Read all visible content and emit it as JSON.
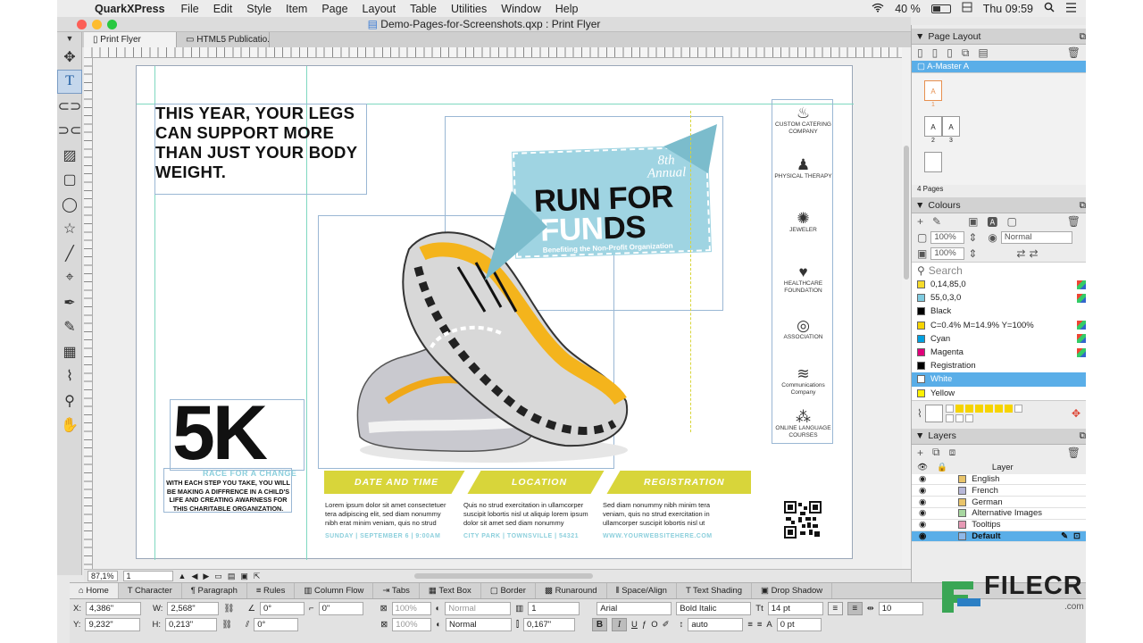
{
  "menubar": {
    "apple_icon": "apple-icon",
    "app_name": "QuarkXPress",
    "menus": [
      "File",
      "Edit",
      "Style",
      "Item",
      "Page",
      "Layout",
      "Table",
      "Utilities",
      "Window",
      "Help"
    ],
    "battery": "40 %",
    "clock": "Thu 09:59"
  },
  "window": {
    "title": "Demo-Pages-for-Screenshots.qxp : Print Flyer",
    "tabs": [
      "Print Flyer",
      "HTML5 Publicatio..."
    ]
  },
  "tools": [
    "pointer-tool",
    "text-content-tool",
    "picture-content-tool",
    "linking-tool",
    "picture-box-tool",
    "rectangle-box-tool",
    "oval-box-tool",
    "star-box-tool",
    "line-tool",
    "bezier-pen-tool",
    "scissors-tool",
    "freehand-tool",
    "table-tool",
    "eyedropper-tool",
    "zoom-tool",
    "pan-tool"
  ],
  "flyer": {
    "headline": "THIS YEAR, YOUR LEGS CAN SUPPORT MORE THAN JUST YOUR BODY WEIGHT.",
    "annual_num": "8th",
    "annual_word": "Annual",
    "run_for": "RUN FOR",
    "funds_a": "FUN",
    "funds_b": "DS",
    "benefit": "Benefiting the Non-Profit Organization",
    "sponsors": [
      {
        "icon": "chef-hat-icon",
        "name": "CUSTOM CATERING COMPANY"
      },
      {
        "icon": "figure-icon",
        "name": "PHYSICAL THERAPY"
      },
      {
        "icon": "gem-icon",
        "name": "JEWELER"
      },
      {
        "icon": "heart-icon",
        "name": "HEALTHCARE FOUNDATION"
      },
      {
        "icon": "speech-icon",
        "name": "ASSOCIATION"
      },
      {
        "icon": "wing-icon",
        "name": "Communications Company"
      },
      {
        "icon": "dots-icon",
        "name": "ONLINE LANGUAGE COURSES"
      }
    ],
    "five_k": "5K",
    "race_change": "RACE FOR A CHANGE",
    "race_body": "WITH EACH STEP YOU TAKE, YOU WILL BE MAKING A DIFFRENCE IN A CHILD'S LIFE AND CREATING AWARNESS FOR THIS CHARITABLE ORGANIZATION.",
    "bar_labels": [
      "DATE AND TIME",
      "LOCATION",
      "REGISTRATION"
    ],
    "col_text": "Lorem ipsum dolor sit amet consectetuer tera adipiscing elit, sed diam nonummy nibh erat minim veniam, quis no strud",
    "col2_text": "Quis no strud exercitation in ullamcorper suscipit lobortis nisl ut aliquip lorem ipsum dolor sit amet sed diam nonummy",
    "col3_text": "Sed diam nonummy nibh minim tera veniam, quis no strud exercitation in ullamcorper suscipit lobortis nisl ut",
    "col1_foot": "SUNDAY   |   SEPTEMBER 6   |   9:00AM",
    "col2_foot": "CITY PARK   |   TOWNSVILLE   |   54321",
    "col3_foot": "WWW.YOURWEBSITEHERE.COM"
  },
  "status": {
    "zoom": "87,1%",
    "page": "1"
  },
  "page_layout": {
    "title": "Page Layout",
    "master": "A-Master A",
    "pages": [
      "1",
      "2",
      "3"
    ],
    "page_letter": "A",
    "count": "4 Pages"
  },
  "colours": {
    "title": "Colours",
    "opacity1": "100%",
    "opacity2": "100%",
    "blend": "Normal",
    "search_placeholder": "Search",
    "list": [
      {
        "name": "0,14,85,0",
        "color": "#f6db2a"
      },
      {
        "name": "55,0,3,0",
        "color": "#7fcbe0"
      },
      {
        "name": "Black",
        "color": "#000000"
      },
      {
        "name": "C=0.4% M=14.9% Y=100%",
        "color": "#f6d400"
      },
      {
        "name": "Cyan",
        "color": "#00a0e0"
      },
      {
        "name": "Magenta",
        "color": "#e0007a"
      },
      {
        "name": "Registration",
        "color": "#000000"
      },
      {
        "name": "White",
        "color": "#ffffff"
      },
      {
        "name": "Yellow",
        "color": "#fff100"
      }
    ]
  },
  "layers": {
    "title": "Layers",
    "header": "Layer",
    "list": [
      {
        "name": "English",
        "color": "#e9c46a"
      },
      {
        "name": "French",
        "color": "#b8b8d8"
      },
      {
        "name": "German",
        "color": "#e9c46a"
      },
      {
        "name": "Alternative Images",
        "color": "#a7d7a0"
      },
      {
        "name": "Tooltips",
        "color": "#e79ab5"
      },
      {
        "name": "Default",
        "color": "#8fb8e8"
      }
    ]
  },
  "bottom": {
    "tabs": [
      "Home",
      "Character",
      "Paragraph",
      "Rules",
      "Column Flow",
      "Tabs",
      "Text Box",
      "Border",
      "Runaround",
      "Space/Align",
      "Text Shading",
      "Drop Shadow"
    ],
    "x_label": "X:",
    "x": "4,386\"",
    "y_label": "Y:",
    "y": "9,232\"",
    "w_label": "W:",
    "w": "2,568\"",
    "h_label": "H:",
    "h": "0,213\"",
    "angle1": "0°",
    "angle2": "0°",
    "corner": "0\"",
    "opacity_a": "100%",
    "opacity_b": "100%",
    "blend_a": "Normal",
    "blend_b": "Normal",
    "cols": "1",
    "gutter": "0,167\"",
    "font": "Arial",
    "style": "Bold Italic",
    "size": "14 pt",
    "leading": "auto",
    "track": "10",
    "baseline": "0 pt"
  },
  "watermark": {
    "brand": "FILECR",
    "domain": ".com"
  }
}
